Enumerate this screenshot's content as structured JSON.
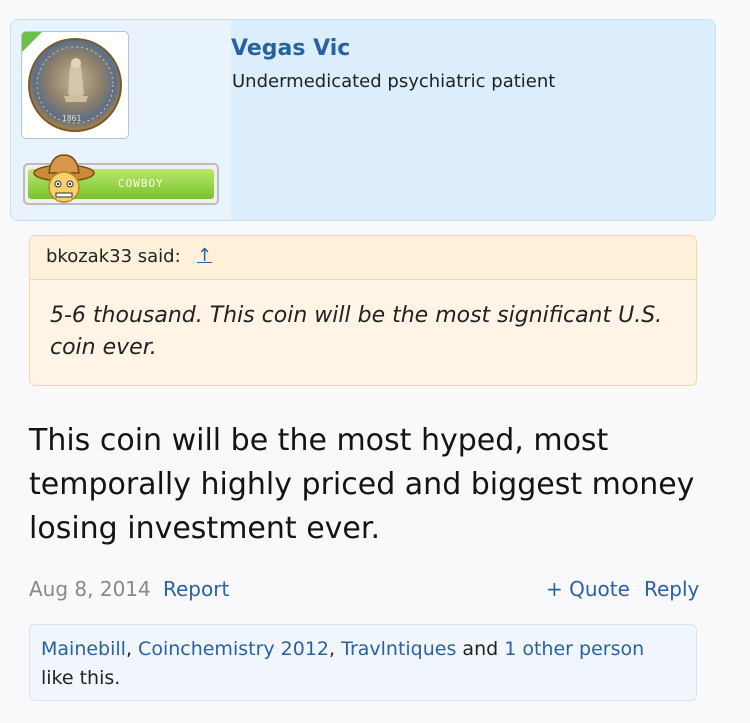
{
  "user": {
    "name": "Vegas Vic",
    "title": "Undermedicated psychiatric patient",
    "badge": "COWBOY",
    "avatar_year": "1861",
    "badge_icon": "cowboy-face-icon"
  },
  "quote": {
    "author": "bkozak33 said:",
    "arrow": "↑",
    "text": "5-6 thousand. This coin will be the most significant U.S. coin ever."
  },
  "post": {
    "body": "This coin will be the most hyped, most temporally highly priced and biggest money losing investment ever.",
    "date": "Aug 8, 2014",
    "report": "Report",
    "quote": "+ Quote",
    "reply": "Reply"
  },
  "likes": {
    "users": [
      "Mainebill",
      "Coinchemistry 2012",
      "Travlntiques"
    ],
    "sep1": ", ",
    "sep2": ", ",
    "and": " and ",
    "other": "1 other person",
    "suffix": "like this."
  },
  "colors": {
    "link": "#2a62a1",
    "card_bg": "#dceefb",
    "quote_bg": "#fff4e5",
    "badge_green": "#79c22f"
  }
}
